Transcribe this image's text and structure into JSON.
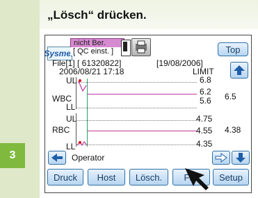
{
  "instruction": "„Lösch“  drücken.",
  "step_number": "3",
  "device": {
    "logo": "Sysmex",
    "status": "nicht Ber.",
    "qc_label": "[ QC einst. ]",
    "top_button": "Top",
    "file_line": "File[1] [  61320822]",
    "file_date": "[19/08/2006]",
    "run_timestamp": "2006/08/21  17:18",
    "limit_header": "LIMIT",
    "operator": "Operator",
    "rows": [
      {
        "name": "WBC",
        "ul": "UL",
        "ll": "LL",
        "limits": [
          "6.8",
          "6.2",
          "5.6"
        ],
        "value": "6.5"
      },
      {
        "name": "RBC",
        "ul": "UL",
        "ll": "LL",
        "limits": [
          "4.75",
          "4.55",
          "4.35"
        ],
        "value": "4.38"
      }
    ],
    "buttons": [
      "Druck",
      "Host",
      "Lösch.",
      "File",
      "Setup"
    ]
  }
}
